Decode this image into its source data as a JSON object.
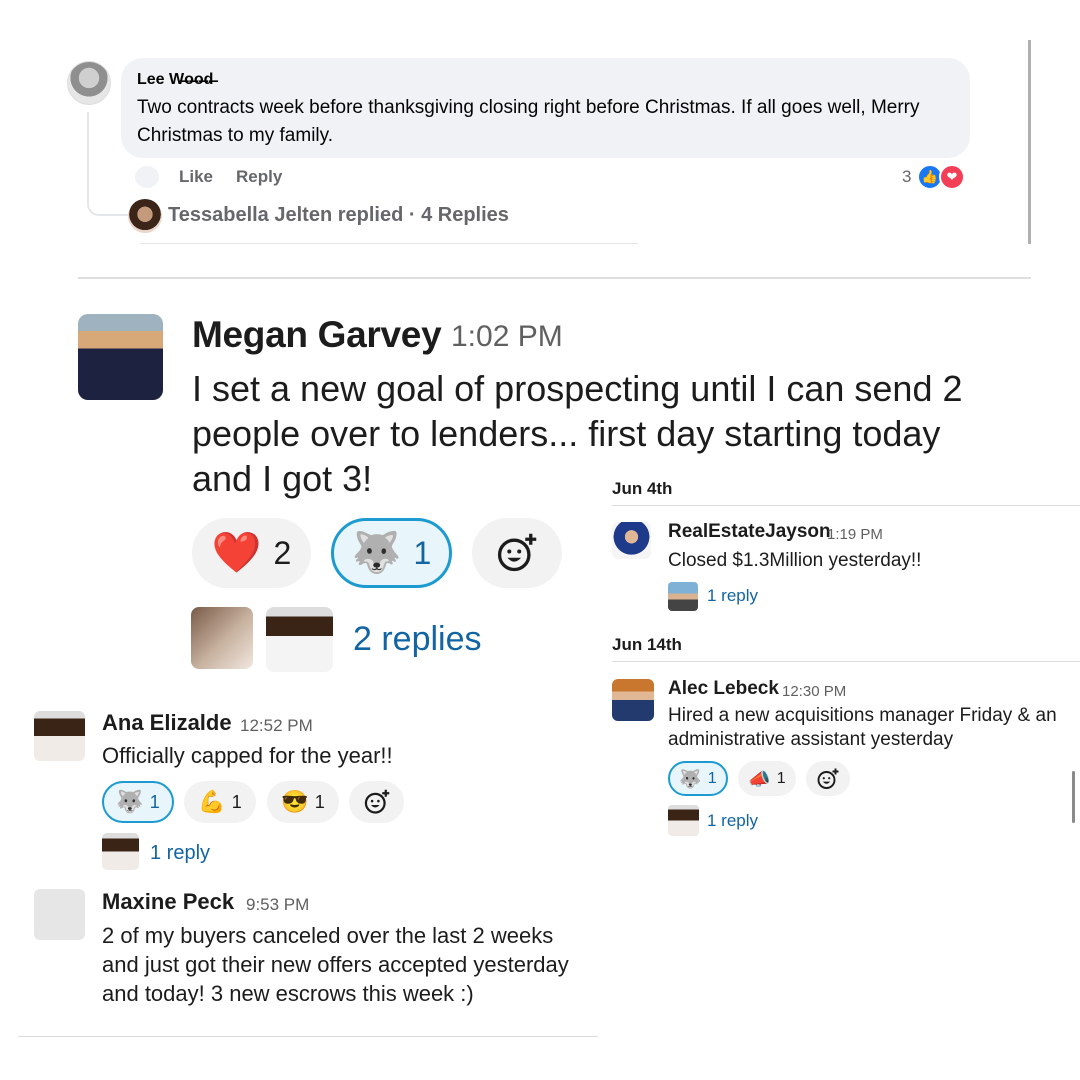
{
  "facebook_comment": {
    "author": "Lee W̶o̶o̶d̶",
    "text": "Two contracts week before thanksgiving closing right before Christmas. If all goes well, Merry Christmas to my family.",
    "like_label": "Like",
    "reply_label": "Reply",
    "reaction_count": "3",
    "reaction_icons": [
      "like-icon",
      "love-icon"
    ],
    "replied_summary": "Tessabella Jelten replied · 4 Replies"
  },
  "megan_message": {
    "author": "Megan Garvey",
    "time": "1:02 PM",
    "text": "I set a new goal of prospecting until I can send 2 people over to lenders... first day starting today and I got 3!",
    "reactions": [
      {
        "emoji": "❤️",
        "count": "2"
      },
      {
        "emoji": "🐺",
        "count": "1",
        "active": true
      }
    ],
    "replies_label": "2 replies"
  },
  "ana_message": {
    "author": "Ana Elizalde",
    "time": "12:52 PM",
    "text": "Officially capped for the year!!",
    "reactions": [
      {
        "emoji": "🐺",
        "count": "1",
        "active": true
      },
      {
        "emoji": "💪",
        "count": "1"
      },
      {
        "emoji": "😎",
        "count": "1"
      }
    ],
    "reply_label": "1 reply"
  },
  "maxine_message": {
    "author": "Maxine Peck",
    "time": "9:53 PM",
    "text": "2 of my buyers canceled over the last 2 weeks and just got their new offers accepted yesterday and today! 3 new escrows this week :)"
  },
  "right_panel": {
    "date1": "Jun 4th",
    "jayson": {
      "author": "RealEstateJayson",
      "time": "1:19 PM",
      "text": "Closed $1.3Million yesterday!!",
      "reply_label": "1 reply"
    },
    "date2": "Jun 14th",
    "alec": {
      "author": "Alec Lebeck",
      "time": "12:30 PM",
      "text": "Hired a new acquisitions manager Friday & an administrative assistant yesterday",
      "reactions": [
        {
          "emoji": "🐺",
          "count": "1",
          "active": true
        },
        {
          "emoji": "📣",
          "count": "1"
        }
      ],
      "reply_label": "1 reply"
    }
  },
  "icons": {
    "add_reaction": "add-reaction-icon",
    "like": "👍",
    "love": "❤"
  },
  "colors": {
    "slack_link": "#1264a3",
    "slack_active_border": "#1d9bd1",
    "fb_blue": "#1877f2",
    "fb_love": "#f33e58"
  }
}
